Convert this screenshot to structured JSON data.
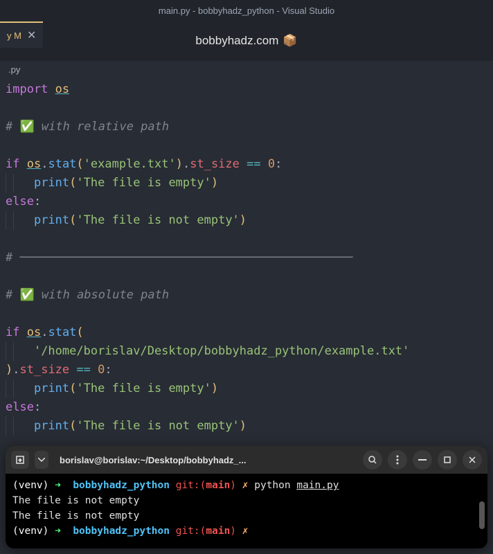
{
  "titleBar": "main.py - bobbyhadz_python - Visual Studio",
  "tab": {
    "label": "y M",
    "closeIcon": "✕"
  },
  "watermark": {
    "text": "bobbyhadz.com",
    "icon": "📦"
  },
  "breadcrumb": ".py",
  "code": {
    "l1_import": "import",
    "l1_os": "os",
    "l3_comment_prefix": "# ",
    "l3_check": "✅",
    "l3_comment_text": " with relative path",
    "l5_if": "if",
    "l5_os": "os",
    "l5_dot1": ".",
    "l5_stat": "stat",
    "l5_p1": "(",
    "l5_str": "'example.txt'",
    "l5_p2": ")",
    "l5_dot2": ".",
    "l5_stsize": "st_size",
    "l5_eq": " == ",
    "l5_zero": "0",
    "l5_colon": ":",
    "l6_indent": "    ",
    "l6_print": "print",
    "l6_p1": "(",
    "l6_str": "'The file is empty'",
    "l6_p2": ")",
    "l7_else": "else",
    "l7_colon": ":",
    "l8_indent": "    ",
    "l8_print": "print",
    "l8_p1": "(",
    "l8_str": "'The file is not empty'",
    "l8_p2": ")",
    "l10_sep": "# ───────────────────────────────────────────────",
    "l12_comment_prefix": "# ",
    "l12_check": "✅",
    "l12_comment_text": " with absolute path",
    "l14_if": "if",
    "l14_os": "os",
    "l14_dot1": ".",
    "l14_stat": "stat",
    "l14_p1": "(",
    "l15_indent": "    ",
    "l15_str": "'/home/borislav/Desktop/bobbyhadz_python/example.txt'",
    "l16_p2": ")",
    "l16_dot2": ".",
    "l16_stsize": "st_size",
    "l16_eq": " == ",
    "l16_zero": "0",
    "l16_colon": ":",
    "l17_indent": "    ",
    "l17_print": "print",
    "l17_p1": "(",
    "l17_str": "'The file is empty'",
    "l17_p2": ")",
    "l18_else": "else",
    "l18_colon": ":",
    "l19_indent": "    ",
    "l19_print": "print",
    "l19_p1": "(",
    "l19_str": "'The file is not empty'",
    "l19_p2": ")"
  },
  "terminal": {
    "title": "borislav@borislav:~/Desktop/bobbyhadz_...",
    "l1_venv": "(venv) ",
    "l1_arrow": "➜  ",
    "l1_dir": "bobbyhadz_python ",
    "l1_git": "git:(",
    "l1_branch": "main",
    "l1_gitclose": ") ",
    "l1_x": "✗ ",
    "l1_cmd": "python ",
    "l1_file": "main.py",
    "l2_out": "The file is not empty",
    "l3_out": "The file is not empty",
    "l4_venv": "(venv) ",
    "l4_arrow": "➜  ",
    "l4_dir": "bobbyhadz_python ",
    "l4_git": "git:(",
    "l4_branch": "main",
    "l4_gitclose": ") ",
    "l4_x": "✗"
  }
}
